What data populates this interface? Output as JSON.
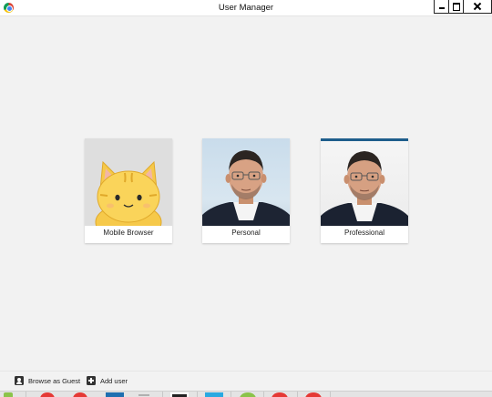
{
  "window": {
    "title": "User Manager",
    "icon": "chrome-icon"
  },
  "profiles": [
    {
      "name": "Mobile Browser",
      "avatar": "cat-avatar-icon",
      "active": false
    },
    {
      "name": "Personal",
      "avatar": "person-photo",
      "active": false
    },
    {
      "name": "Professional",
      "avatar": "person-photo",
      "active": true
    }
  ],
  "footer": {
    "guest_label": "Browse as Guest",
    "add_user_label": "Add user"
  },
  "colors": {
    "background": "#f2f2f2",
    "active_profile_accent": "#1e5e8c"
  }
}
